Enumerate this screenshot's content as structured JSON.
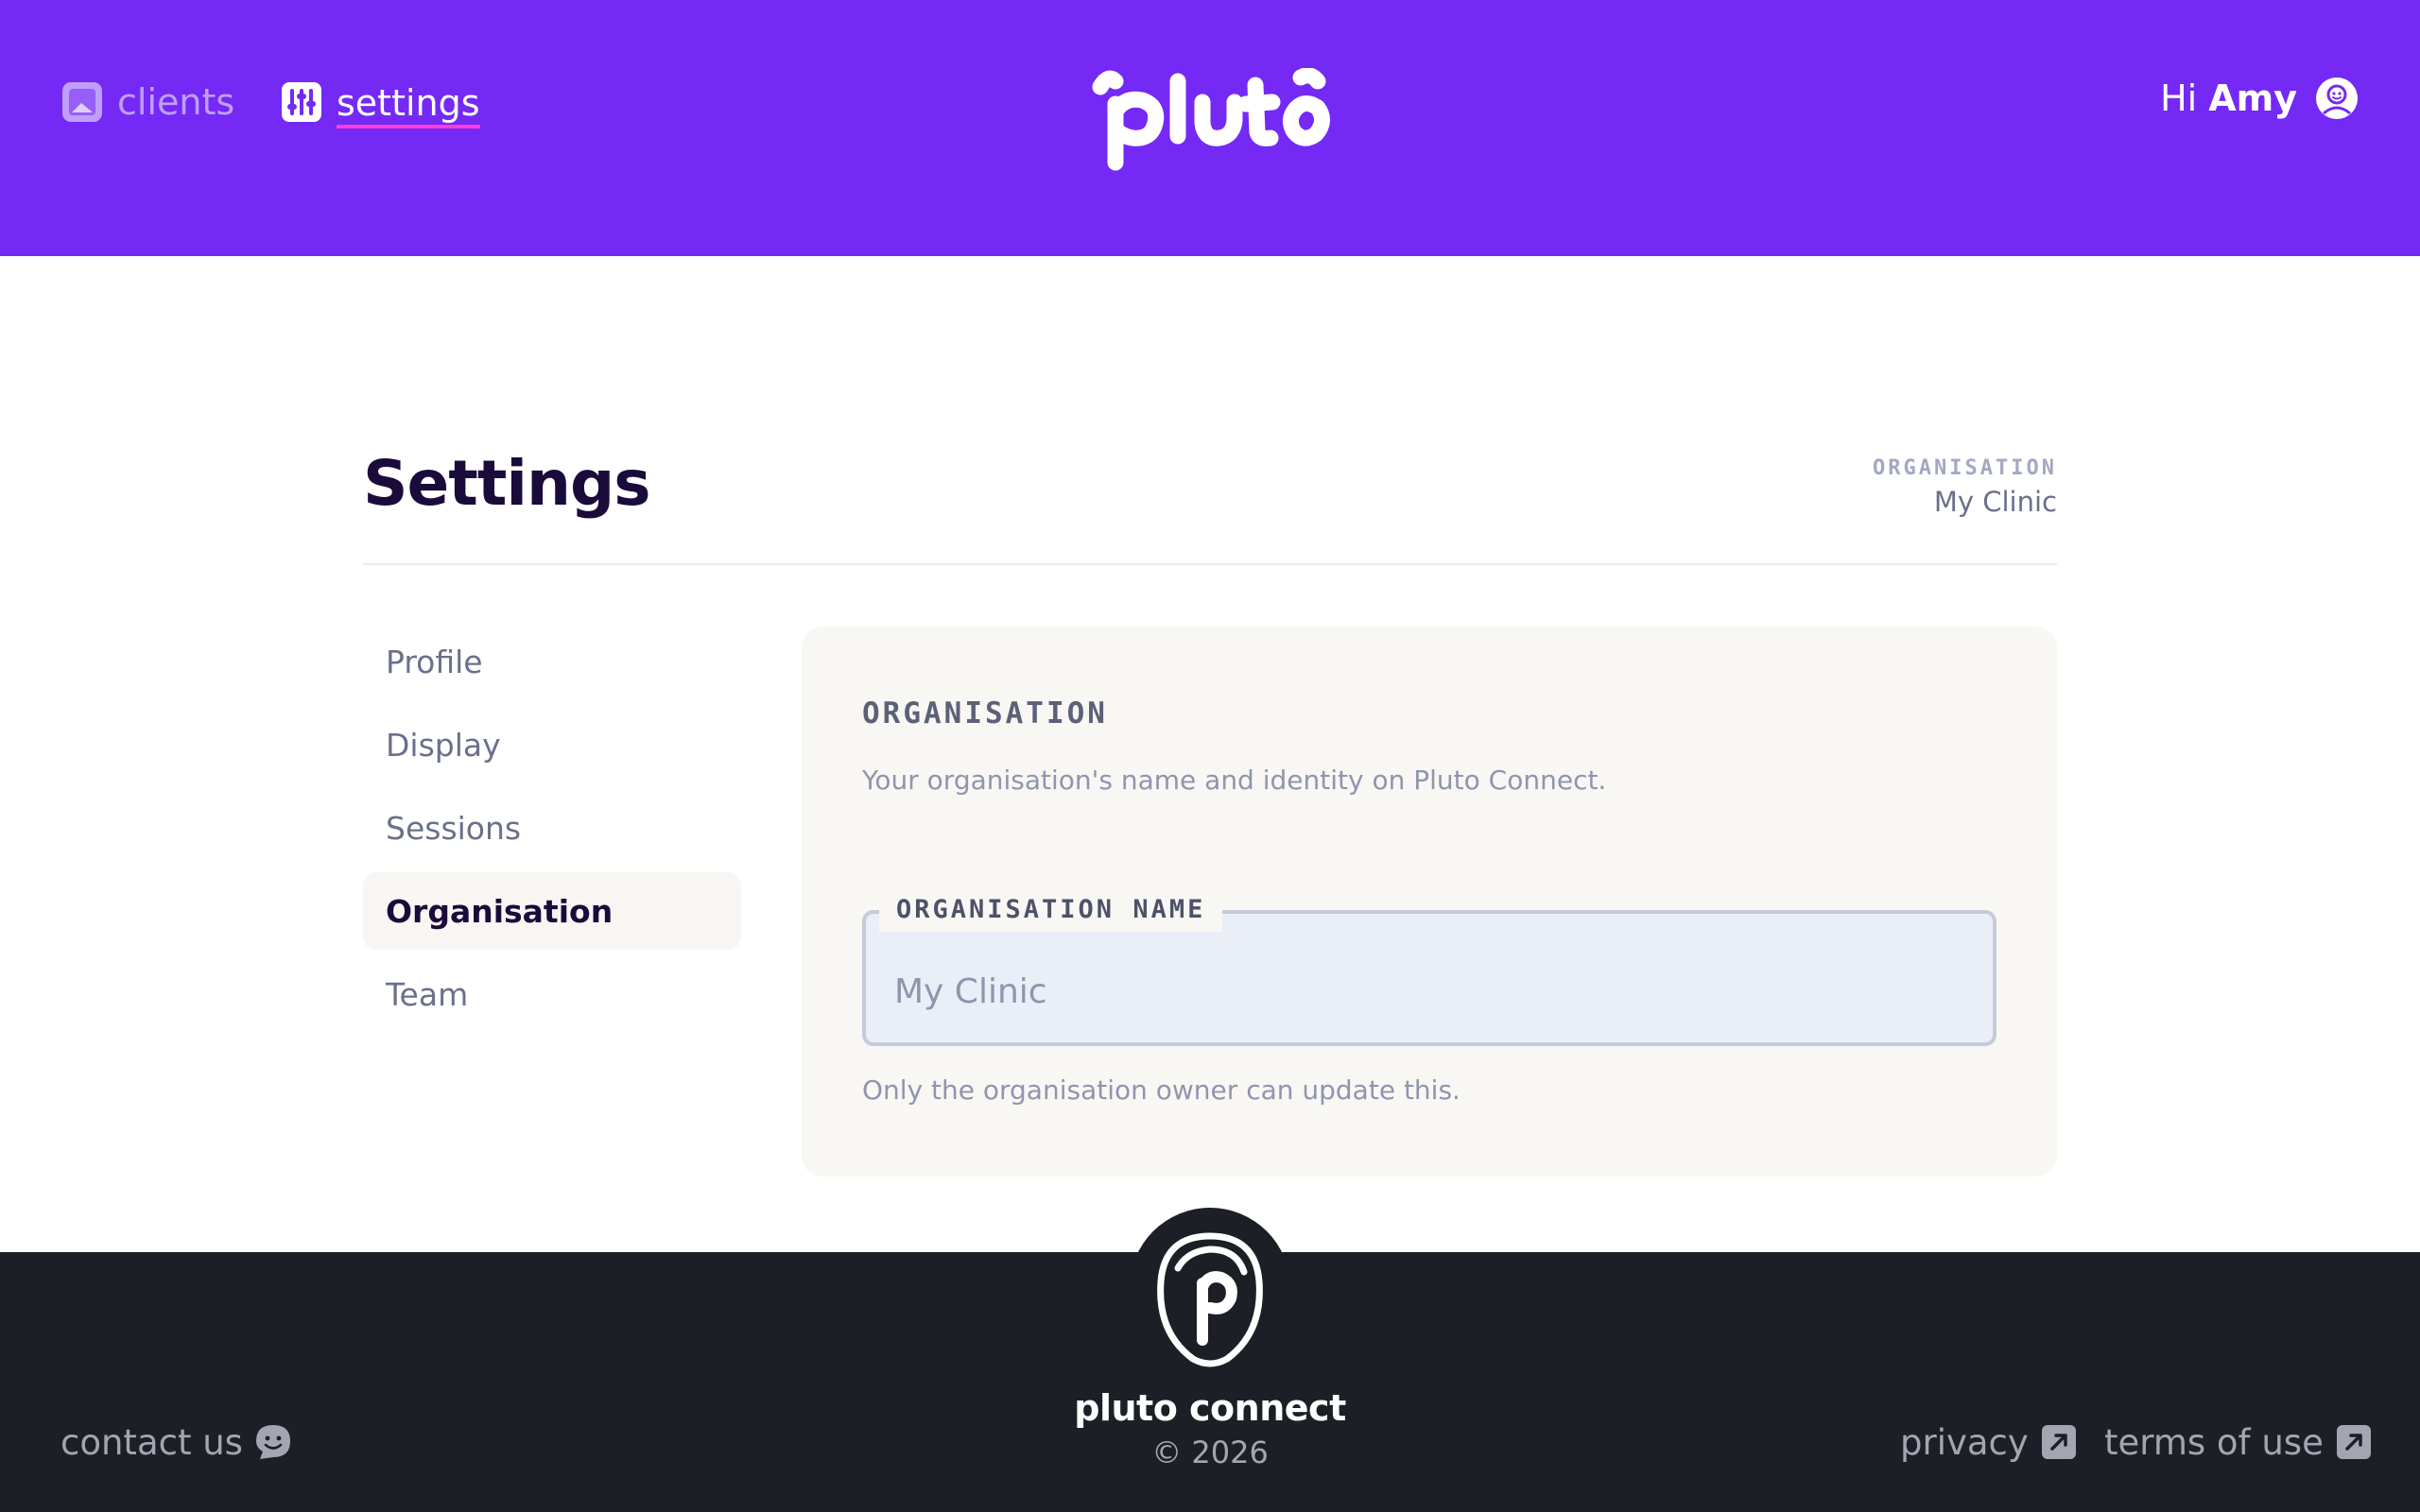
{
  "header": {
    "nav": [
      {
        "label": "clients",
        "icon": "clients-icon",
        "active": false
      },
      {
        "label": "settings",
        "icon": "settings-sliders-icon",
        "active": true
      }
    ],
    "logo_text": "pluto",
    "greeting": {
      "prefix": "Hi",
      "name": "Amy",
      "icon": "user-avatar-icon"
    },
    "background_color": "#7429f5",
    "active_underline_color": "#ff3ddb"
  },
  "page": {
    "title": "Settings",
    "org_label": "ORGANISATION",
    "org_value": "My Clinic"
  },
  "side_nav": {
    "items": [
      {
        "label": "Profile",
        "active": false
      },
      {
        "label": "Display",
        "active": false
      },
      {
        "label": "Sessions",
        "active": false
      },
      {
        "label": "Organisation",
        "active": true
      },
      {
        "label": "Team",
        "active": false
      }
    ]
  },
  "card": {
    "title": "ORGANISATION",
    "description": "Your organisation's name and identity on Pluto Connect.",
    "field": {
      "label": "ORGANISATION NAME",
      "value": "My Clinic",
      "disabled": true
    },
    "help_text": "Only the organisation owner can update this."
  },
  "footer": {
    "brand": "pluto connect",
    "copyright": "© 2026",
    "contact": {
      "label": "contact us",
      "icon": "chat-smile-icon"
    },
    "privacy": {
      "label": "privacy",
      "icon": "external-link-icon"
    },
    "terms": {
      "label": "terms of use",
      "icon": "external-link-icon"
    },
    "background_color": "#1c1f25"
  }
}
